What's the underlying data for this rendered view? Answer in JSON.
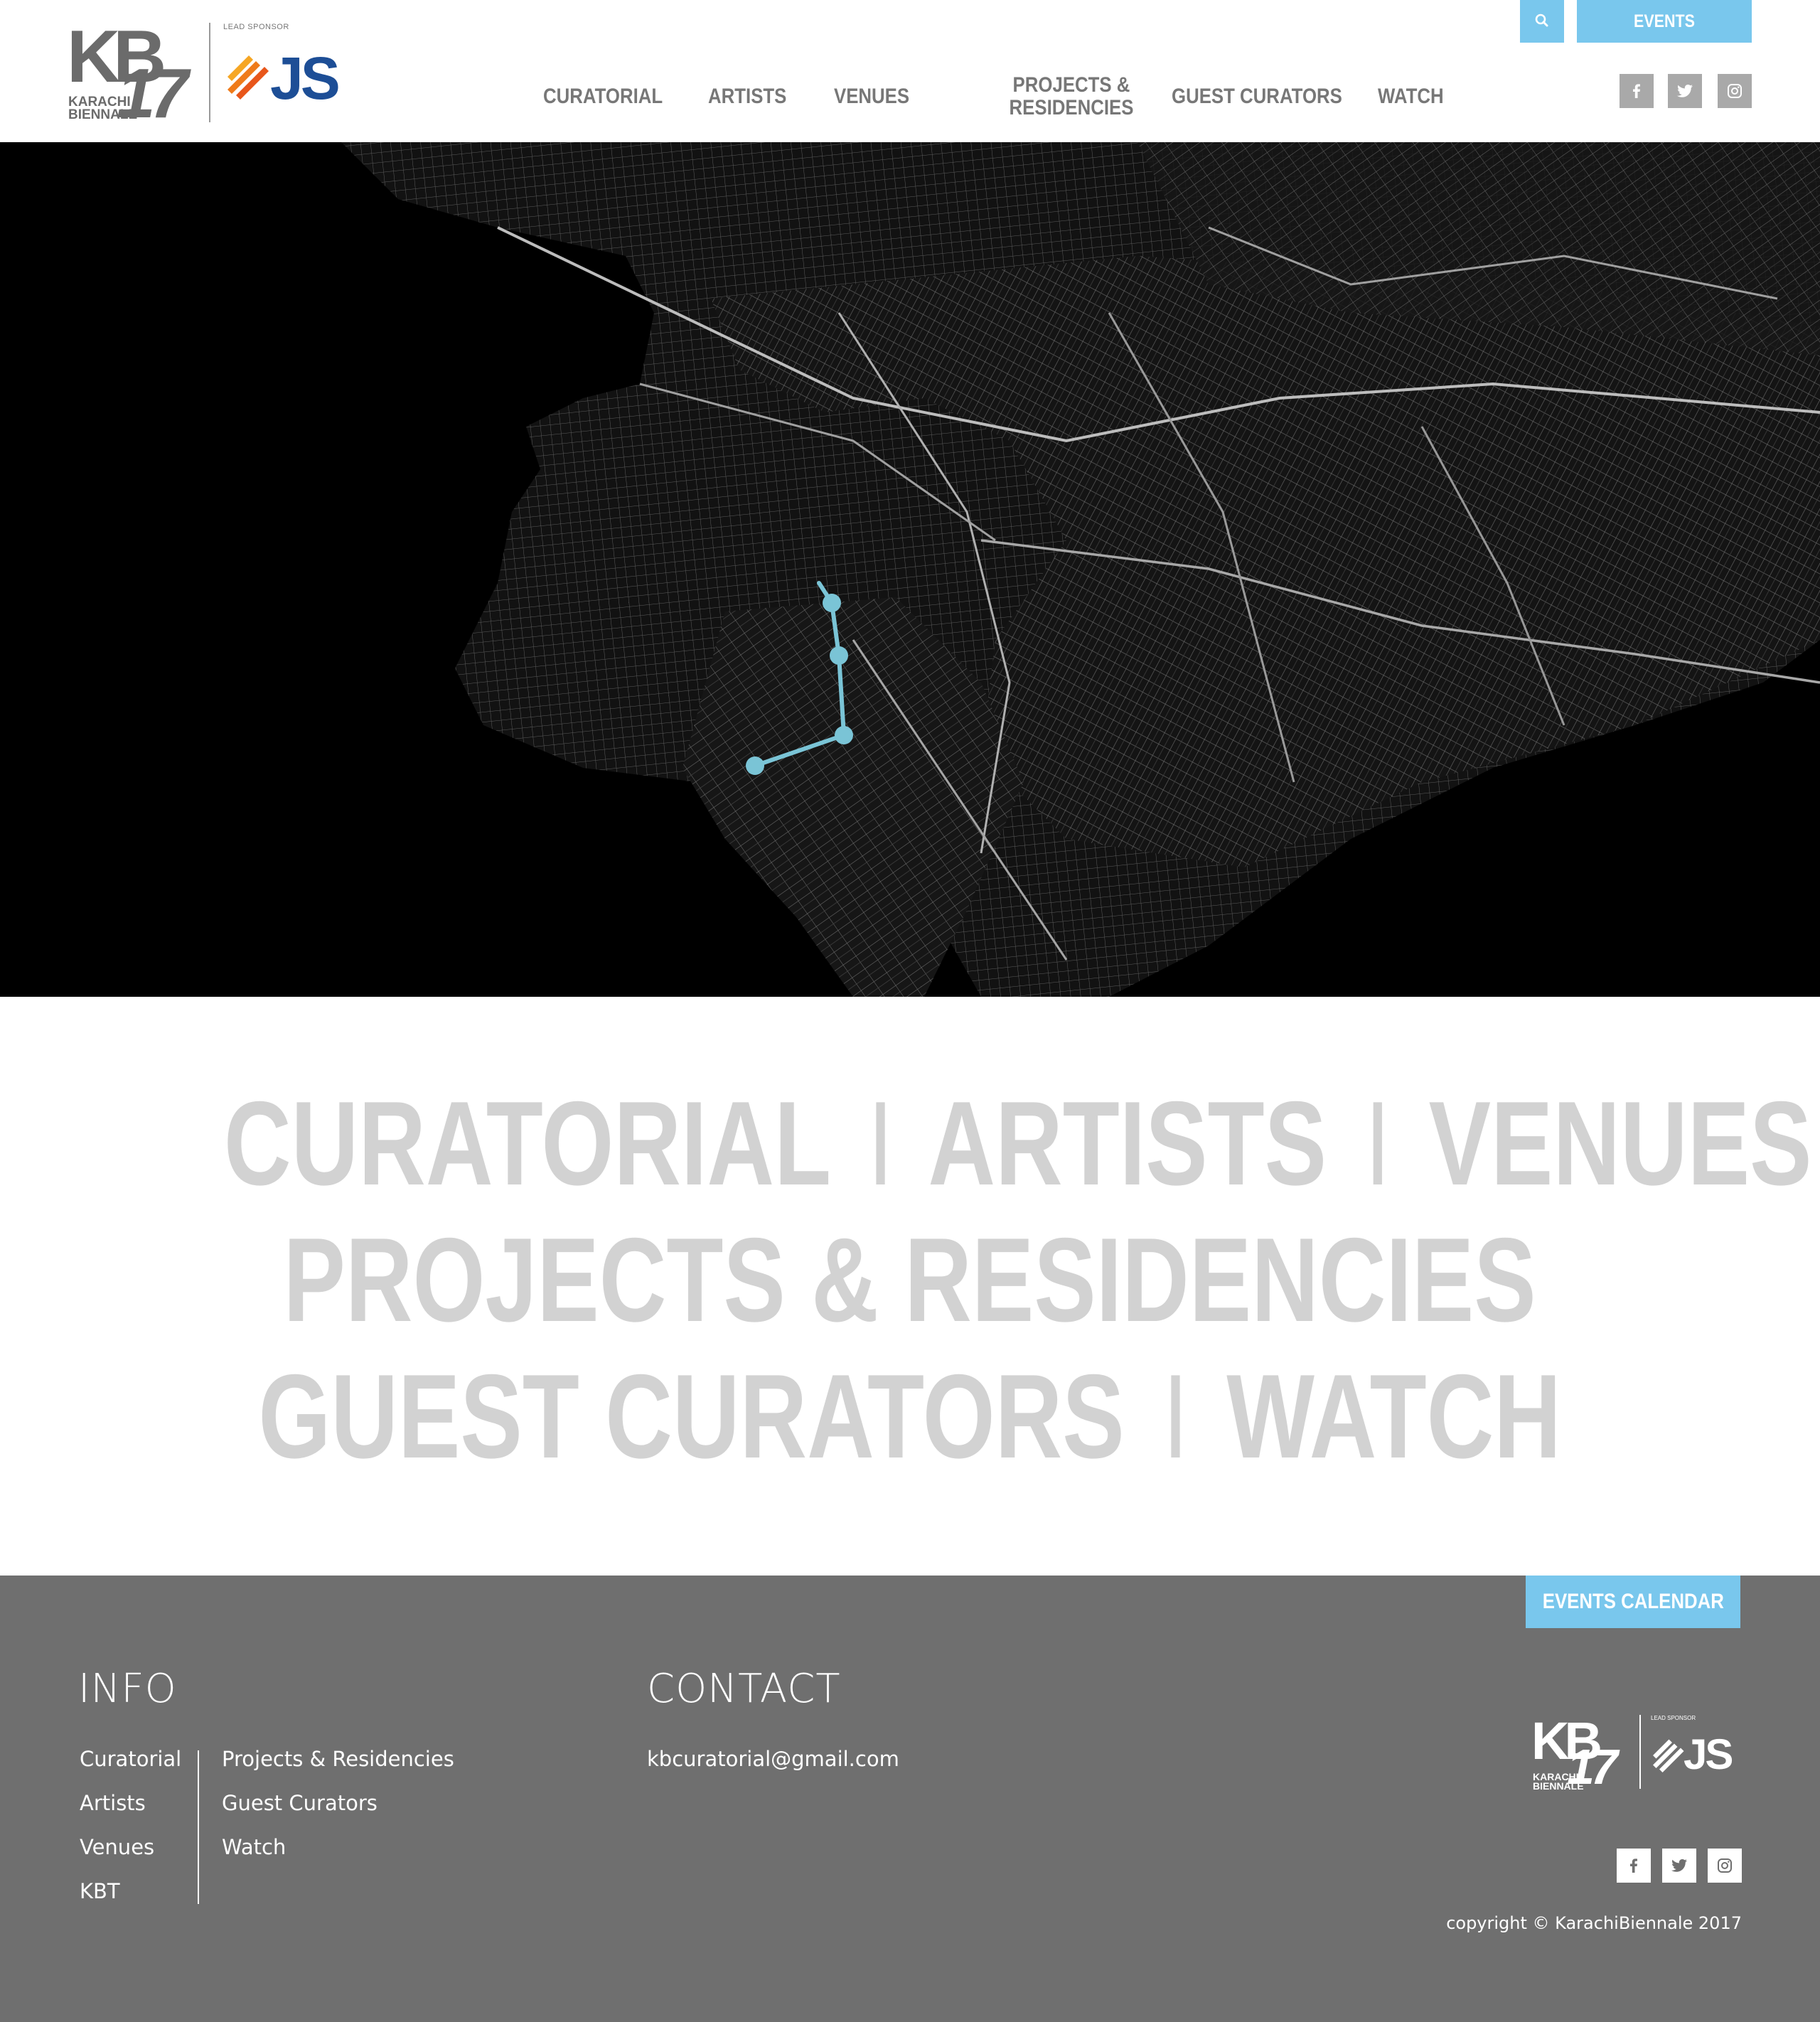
{
  "brand": {
    "logo_text": "KB17",
    "logo_line1": "KARACHI",
    "logo_line2": "BIENNALE",
    "sponsor_label": "LEAD SPONSOR",
    "sponsor_name": "JS"
  },
  "nav": {
    "items": [
      {
        "label": "CURATORIAL"
      },
      {
        "label": "ARTISTS"
      },
      {
        "label": "VENUES"
      },
      {
        "label": "PROJECTS &",
        "label2": "RESIDENCIES"
      },
      {
        "label": "GUEST CURATORS"
      },
      {
        "label": "WATCH"
      }
    ]
  },
  "header": {
    "search_icon": "search-icon",
    "events_label": "EVENTS CALENDAR"
  },
  "social": {
    "icons": [
      "facebook-icon",
      "twitter-icon",
      "instagram-icon"
    ]
  },
  "hero": {
    "route_color": "#7ac4d6",
    "route_stops": 4
  },
  "biglinks": {
    "line1": [
      "CURATORIAL",
      "ARTISTS",
      "VENUES"
    ],
    "line2": "PROJECTS & RESIDENCIES",
    "line3": [
      "GUEST CURATORS",
      "WATCH"
    ],
    "separator": "I"
  },
  "footer": {
    "events_label": "EVENTS CALENDAR",
    "info_title": "INFO",
    "contact_title": "CONTACT",
    "info_col1": [
      "Curatorial",
      "Artists",
      "Venues",
      "KBT"
    ],
    "info_col2": [
      "Projects & Residencies",
      "Guest Curators",
      "Watch"
    ],
    "email": "kbcuratorial@gmail.com",
    "copyright": "copyright © KarachiBiennale 2017"
  },
  "colors": {
    "accent": "#79c7ed",
    "nav_text": "#777777",
    "big_text": "#d2d2d2",
    "footer_bg": "#6f6f6f",
    "js_blue": "#1d4e96",
    "js_orange": "#f29100"
  }
}
